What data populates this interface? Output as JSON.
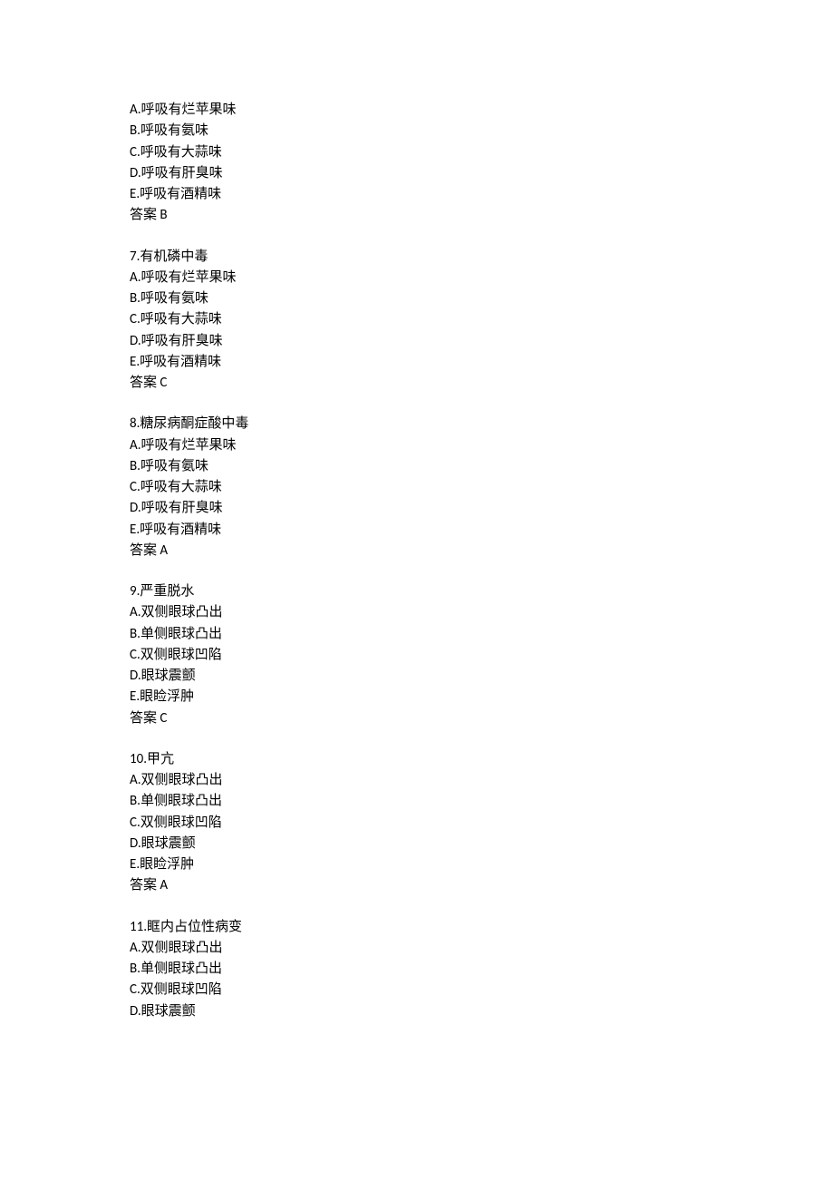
{
  "blocks": [
    {
      "question": "",
      "options": [
        "A.呼吸有烂苹果味",
        "B.呼吸有氨味",
        "C.呼吸有大蒜味",
        "D.呼吸有肝臭味",
        "E.呼吸有酒精味"
      ],
      "answer": "答案 B"
    },
    {
      "question": "7.有机磷中毒",
      "options": [
        "A.呼吸有烂苹果味",
        "B.呼吸有氨味",
        "C.呼吸有大蒜味",
        "D.呼吸有肝臭味",
        "E.呼吸有酒精味"
      ],
      "answer": "答案 C"
    },
    {
      "question": "8.糖尿病酮症酸中毒",
      "options": [
        "A.呼吸有烂苹果味",
        "B.呼吸有氨味",
        "C.呼吸有大蒜味",
        "D.呼吸有肝臭味",
        "E.呼吸有酒精味"
      ],
      "answer": "答案 A"
    },
    {
      "question": "9.严重脱水",
      "options": [
        "A.双侧眼球凸出",
        "B.单侧眼球凸出",
        "C.双侧眼球凹陷",
        "D.眼球震颤",
        "E.眼睑浮肿"
      ],
      "answer": "答案 C"
    },
    {
      "question": "10.甲亢",
      "options": [
        "A.双侧眼球凸出",
        "B.单侧眼球凸出",
        "C.双侧眼球凹陷",
        "D.眼球震颤",
        "E.眼睑浮肿"
      ],
      "answer": "答案 A"
    },
    {
      "question": "11.眶内占位性病变",
      "options": [
        "A.双侧眼球凸出",
        "B.单侧眼球凸出",
        "C.双侧眼球凹陷",
        "D.眼球震颤"
      ],
      "answer": ""
    }
  ]
}
